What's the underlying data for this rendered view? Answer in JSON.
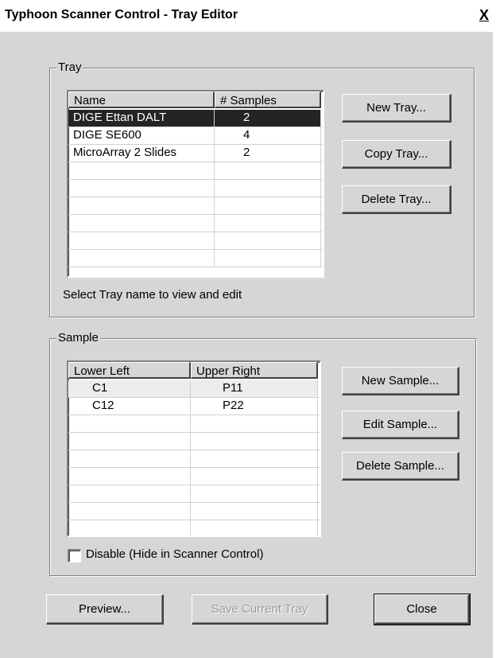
{
  "window": {
    "title": "Typhoon Scanner Control - Tray Editor",
    "close_glyph": "X"
  },
  "tray": {
    "group_label": "Tray",
    "columns": [
      "Name",
      "# Samples"
    ],
    "rows": [
      {
        "name": "DIGE Ettan DALT",
        "samples": "2"
      },
      {
        "name": "DIGE SE600",
        "samples": "4"
      },
      {
        "name": "MicroArray 2 Slides",
        "samples": "2"
      }
    ],
    "selected_row": 0,
    "hint": "Select Tray name to view and edit",
    "buttons": {
      "new": "New Tray...",
      "copy": "Copy Tray...",
      "delete": "Delete Tray..."
    }
  },
  "sample": {
    "group_label": "Sample",
    "columns": [
      "Lower Left",
      "Upper Right"
    ],
    "rows": [
      {
        "lower_left": "C1",
        "upper_right": "P11"
      },
      {
        "lower_left": "C12",
        "upper_right": "P22"
      }
    ],
    "buttons": {
      "new": "New Sample...",
      "edit": "Edit Sample...",
      "delete": "Delete Sample..."
    },
    "disable_checkbox_label": "Disable (Hide in Scanner Control)",
    "disable_checked": false
  },
  "footer": {
    "preview": "Preview...",
    "save": "Save Current Tray",
    "close": "Close"
  },
  "colors": {
    "selection": "#242424",
    "dialog_bg": "#d6d6d6"
  }
}
